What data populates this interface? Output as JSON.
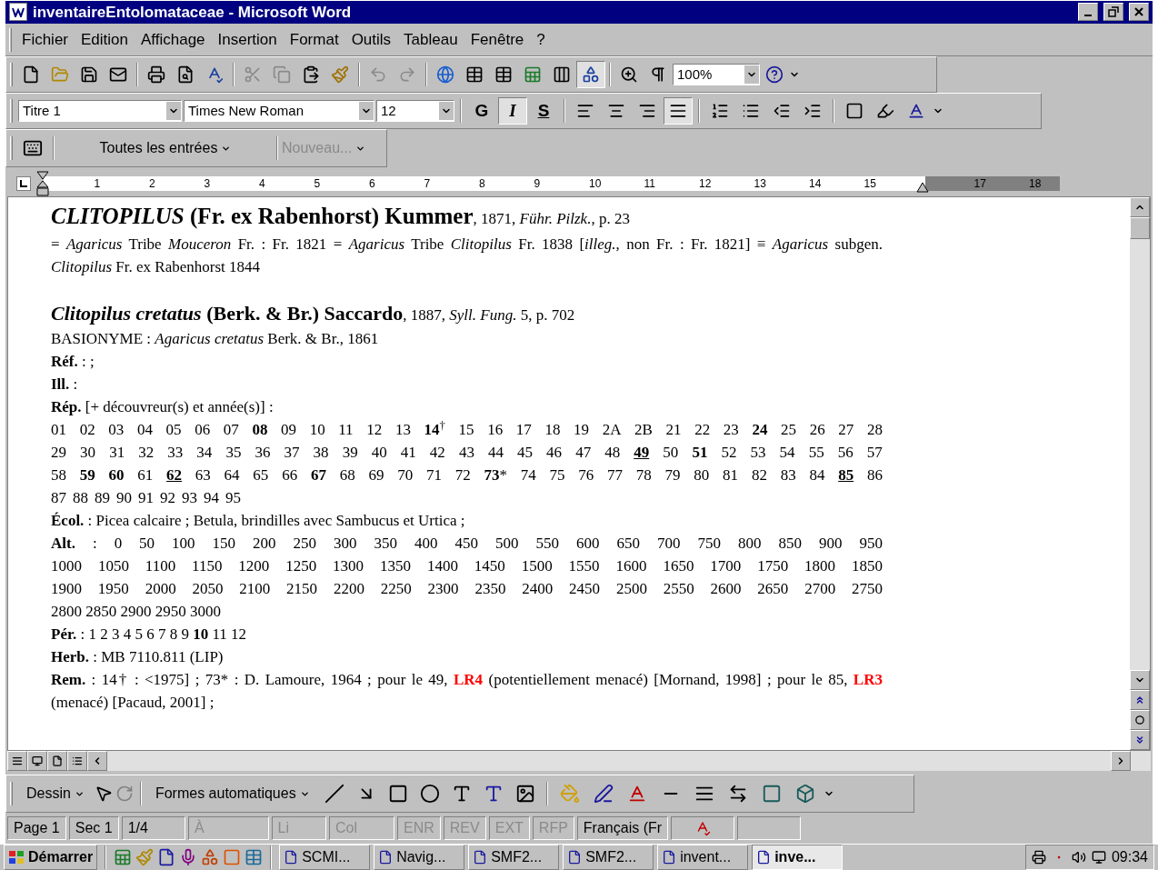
{
  "window": {
    "title": "inventaireEntolomataceae - Microsoft Word"
  },
  "menu": [
    {
      "label": "Fichier"
    },
    {
      "label": "Edition"
    },
    {
      "label": "Affichage"
    },
    {
      "label": "Insertion"
    },
    {
      "label": "Format"
    },
    {
      "label": "Outils"
    },
    {
      "label": "Tableau"
    },
    {
      "label": "Fenêtre"
    },
    {
      "label": "?"
    }
  ],
  "standard_toolbar": {
    "zoom": "100%",
    "buttons": [
      {
        "kind": "new",
        "pressed": false,
        "disabled": false
      },
      {
        "kind": "open",
        "pressed": false,
        "disabled": false
      },
      {
        "kind": "save",
        "pressed": false,
        "disabled": false
      },
      {
        "kind": "mail",
        "pressed": false,
        "disabled": false
      },
      {
        "kind": "sep"
      },
      {
        "kind": "print",
        "pressed": false,
        "disabled": false
      },
      {
        "kind": "preview",
        "pressed": false,
        "disabled": false
      },
      {
        "kind": "spelling",
        "pressed": false,
        "disabled": false
      },
      {
        "kind": "sep"
      },
      {
        "kind": "cut",
        "pressed": false,
        "disabled": true
      },
      {
        "kind": "copy",
        "pressed": false,
        "disabled": true
      },
      {
        "kind": "paste",
        "pressed": false,
        "disabled": false
      },
      {
        "kind": "brush",
        "pressed": false,
        "disabled": false
      },
      {
        "kind": "sep"
      },
      {
        "kind": "undo",
        "pressed": false,
        "disabled": true
      },
      {
        "kind": "redo",
        "pressed": false,
        "disabled": true
      },
      {
        "kind": "sep"
      },
      {
        "kind": "web",
        "pressed": false,
        "disabled": false
      },
      {
        "kind": "tables",
        "pressed": false,
        "disabled": false
      },
      {
        "kind": "table",
        "pressed": false,
        "disabled": false
      },
      {
        "kind": "sheet",
        "pressed": false,
        "disabled": false
      },
      {
        "kind": "columns",
        "pressed": false,
        "disabled": false
      },
      {
        "kind": "drawing",
        "pressed": true,
        "disabled": false
      },
      {
        "kind": "sep"
      },
      {
        "kind": "map",
        "pressed": false,
        "disabled": false
      },
      {
        "kind": "pilcrow",
        "pressed": false,
        "disabled": false
      }
    ]
  },
  "formatting_toolbar": {
    "style": "Titre 1",
    "font": "Times New Roman",
    "size": "12",
    "text_buttons": [
      {
        "label": "G",
        "pressed": false
      },
      {
        "label": "I",
        "pressed": true
      },
      {
        "label": "S",
        "pressed": false
      }
    ],
    "buttons": [
      {
        "kind": "align-left",
        "pressed": false
      },
      {
        "kind": "align-center",
        "pressed": false
      },
      {
        "kind": "align-right",
        "pressed": false
      },
      {
        "kind": "justify",
        "pressed": true
      },
      {
        "kind": "sep"
      },
      {
        "kind": "numbering",
        "pressed": false
      },
      {
        "kind": "bullets",
        "pressed": false
      },
      {
        "kind": "outdent",
        "pressed": false
      },
      {
        "kind": "indent",
        "pressed": false
      },
      {
        "kind": "sep"
      },
      {
        "kind": "borders",
        "pressed": false
      },
      {
        "kind": "highlight",
        "pressed": false
      },
      {
        "kind": "font-color",
        "pressed": false
      }
    ]
  },
  "review_toolbar": {
    "entries": "Toutes les entrées",
    "new": "Nouveau..."
  },
  "ruler": {
    "labels": [
      "1",
      "2",
      "3",
      "4",
      "5",
      "6",
      "7",
      "8",
      "9",
      "10",
      "11",
      "12",
      "13",
      "14",
      "15",
      "17",
      "18"
    ]
  },
  "document": {
    "genus_heading": {
      "name": "*CLITOPILUS* (Fr. ex Rabenhorst) Kummer",
      "citation": ", 1871, *Führ. Pilzk.*, p. 23"
    },
    "synonymy": "= *Agaricus* Tribe *Mouceron* Fr. : Fr. 1821 = *Agaricus* Tribe *Clitopilus* Fr. 1838 [*illeg.*, non Fr. : Fr. 1821] ≡ *Agaricus* subgen. *Clitopilus* Fr. ex Rabenhorst 1844",
    "species_heading": {
      "name": "*Clitopilus cretatus* (Berk. & Br.) Saccardo",
      "citation": ", 1887, *Syll. Fung.* 5, p. 702"
    },
    "basionym": "BASIONYME : *Agaricus cretatus* Berk. & Br., 1861",
    "fields": [
      "**Réf.** : ;",
      "**Ill.** :",
      "**Rép.** [+ découvreur(s) et année(s)] :"
    ],
    "rep_lines": [
      [
        {
          "text": "01",
          "underlined": false
        },
        {
          "text": "02",
          "underlined": false
        },
        {
          "text": "03",
          "underlined": false
        },
        {
          "text": "04",
          "underlined": false
        },
        {
          "text": "05",
          "underlined": false
        },
        {
          "text": "06",
          "underlined": false
        },
        {
          "text": "07",
          "underlined": false
        },
        {
          "text": "**08**",
          "underlined": false
        },
        {
          "text": "09",
          "underlined": false
        },
        {
          "text": "10",
          "underlined": false
        },
        {
          "text": "11",
          "underlined": false
        },
        {
          "text": "12",
          "underlined": false
        },
        {
          "text": "13",
          "underlined": false
        },
        {
          "text": "**14**$^{†}$",
          "underlined": false
        },
        {
          "text": "15",
          "underlined": false
        },
        {
          "text": "16",
          "underlined": false
        },
        {
          "text": "17",
          "underlined": false
        },
        {
          "text": "18",
          "underlined": false
        },
        {
          "text": "19",
          "underlined": false
        },
        {
          "text": "2A",
          "underlined": false
        },
        {
          "text": "2B",
          "underlined": false
        },
        {
          "text": "21",
          "underlined": false
        },
        {
          "text": "22",
          "underlined": false
        },
        {
          "text": "23",
          "underlined": false
        },
        {
          "text": "**24**",
          "underlined": false
        },
        {
          "text": "25",
          "underlined": false
        },
        {
          "text": "26",
          "underlined": false
        },
        {
          "text": "27",
          "underlined": false
        },
        {
          "text": "28",
          "underlined": false
        }
      ],
      [
        {
          "text": "29",
          "underlined": false
        },
        {
          "text": "30",
          "underlined": false
        },
        {
          "text": "31",
          "underlined": false
        },
        {
          "text": "32",
          "underlined": false
        },
        {
          "text": "33",
          "underlined": false
        },
        {
          "text": "34",
          "underlined": false
        },
        {
          "text": "35",
          "underlined": false
        },
        {
          "text": "36",
          "underlined": false
        },
        {
          "text": "37",
          "underlined": false
        },
        {
          "text": "38",
          "underlined": false
        },
        {
          "text": "39",
          "underlined": false
        },
        {
          "text": "40",
          "underlined": false
        },
        {
          "text": "41",
          "underlined": false
        },
        {
          "text": "42",
          "underlined": false
        },
        {
          "text": "43",
          "underlined": false
        },
        {
          "text": "44",
          "underlined": false
        },
        {
          "text": "45",
          "underlined": false
        },
        {
          "text": "46",
          "underlined": false
        },
        {
          "text": "47",
          "underlined": false
        },
        {
          "text": "48",
          "underlined": false
        },
        {
          "text": "**49**",
          "underlined": true
        },
        {
          "text": "50",
          "underlined": false
        },
        {
          "text": "**51**",
          "underlined": false
        },
        {
          "text": "52",
          "underlined": false
        },
        {
          "text": "53",
          "underlined": false
        },
        {
          "text": "54",
          "underlined": false
        },
        {
          "text": "55",
          "underlined": false
        },
        {
          "text": "56",
          "underlined": false
        },
        {
          "text": "57",
          "underlined": false
        }
      ],
      [
        {
          "text": "58",
          "underlined": false
        },
        {
          "text": "**59**",
          "underlined": false
        },
        {
          "text": "**60**",
          "underlined": false
        },
        {
          "text": "61",
          "underlined": false
        },
        {
          "text": "**62**",
          "underlined": true
        },
        {
          "text": "63",
          "underlined": false
        },
        {
          "text": "64",
          "underlined": false
        },
        {
          "text": "65",
          "underlined": false
        },
        {
          "text": "66",
          "underlined": false
        },
        {
          "text": "**67**",
          "underlined": false
        },
        {
          "text": "68",
          "underlined": false
        },
        {
          "text": "69",
          "underlined": false
        },
        {
          "text": "70",
          "underlined": false
        },
        {
          "text": "71",
          "underlined": false
        },
        {
          "text": "72",
          "underlined": false
        },
        {
          "text": "**73***",
          "underlined": false
        },
        {
          "text": "74",
          "underlined": false
        },
        {
          "text": "75",
          "underlined": false
        },
        {
          "text": "76",
          "underlined": false
        },
        {
          "text": "77",
          "underlined": false
        },
        {
          "text": "78",
          "underlined": false
        },
        {
          "text": "79",
          "underlined": false
        },
        {
          "text": "80",
          "underlined": false
        },
        {
          "text": "81",
          "underlined": false
        },
        {
          "text": "82",
          "underlined": false
        },
        {
          "text": "83",
          "underlined": false
        },
        {
          "text": "84",
          "underlined": false
        },
        {
          "text": "**85**",
          "underlined": true
        },
        {
          "text": "86",
          "underlined": false
        }
      ],
      [
        {
          "text": "87",
          "underlined": false
        },
        {
          "text": "88",
          "underlined": false
        },
        {
          "text": "89",
          "underlined": false
        },
        {
          "text": "90",
          "underlined": false
        },
        {
          "text": "91",
          "underlined": false
        },
        {
          "text": "92",
          "underlined": false
        },
        {
          "text": "93",
          "underlined": false
        },
        {
          "text": "94",
          "underlined": false
        },
        {
          "text": "95",
          "underlined": false
        }
      ]
    ],
    "ecology": "**Écol.** : Picea calcaire ; Betula, brindilles avec Sambucus et Urtica ;",
    "alt_lines": [
      "**Alt.** : 0 50 100 150 200 250 300 350 400 450 500 550 600 650 700 750 800 850 900 950",
      "1000 1050 1100 1150 1200 1250 1300 1350 1400 1450 1500 1550 1600 1650 1700 1750 1800 1850",
      "1900 1950 2000 2050 2100 2150 2200 2250 2300 2350 2400 2450 2500 2550 2600 2650 2700 2750",
      "2800 2850 2900 2950 3000"
    ],
    "period": "**Pér.** : 1 2 3 4 5 6 7 8 9 **10** 11 12",
    "herbarium": "**Herb.** : MB 7110.811 (LIP)",
    "remarks": [
      {
        "kind": "text",
        "text": "**Rem.** : 14† : <1975] ; 73* : D. Lamoure, 1964 ; pour le 49, "
      },
      {
        "kind": "threat",
        "text": "LR4"
      },
      {
        "kind": "text",
        "text": " (potentiellement menacé) [Mornand, 1998] ; pour le 85, "
      },
      {
        "kind": "threat",
        "text": "LR3"
      },
      {
        "kind": "text",
        "text": " (menacé) [Pacaud, 2001] ;"
      }
    ]
  },
  "drawing_toolbar": {
    "draw": "Dessin",
    "autoshapes": "Formes automatiques"
  },
  "status_bar": [
    {
      "text": "Page 1",
      "disabled": false
    },
    {
      "text": "Sec 1",
      "disabled": false
    },
    {
      "text": "1/4",
      "disabled": false
    },
    {
      "text": "À",
      "disabled": true
    },
    {
      "text": "Li",
      "disabled": true
    },
    {
      "text": "Col",
      "disabled": true
    },
    {
      "text": "ENR",
      "disabled": true
    },
    {
      "text": "REV",
      "disabled": true
    },
    {
      "text": "EXT",
      "disabled": true
    },
    {
      "text": "RFP",
      "disabled": true
    },
    {
      "text": "Français (Fr",
      "disabled": false
    }
  ],
  "taskbar": {
    "start": "Démarrer",
    "tasks": [
      {
        "label": "SCMI...",
        "selected": false
      },
      {
        "label": "Navig...",
        "selected": false
      },
      {
        "label": "SMF2...",
        "selected": false
      },
      {
        "label": "SMF2...",
        "selected": false
      },
      {
        "label": "invent...",
        "selected": false
      },
      {
        "label": "inve...",
        "selected": true
      }
    ],
    "clock": "09:34"
  }
}
